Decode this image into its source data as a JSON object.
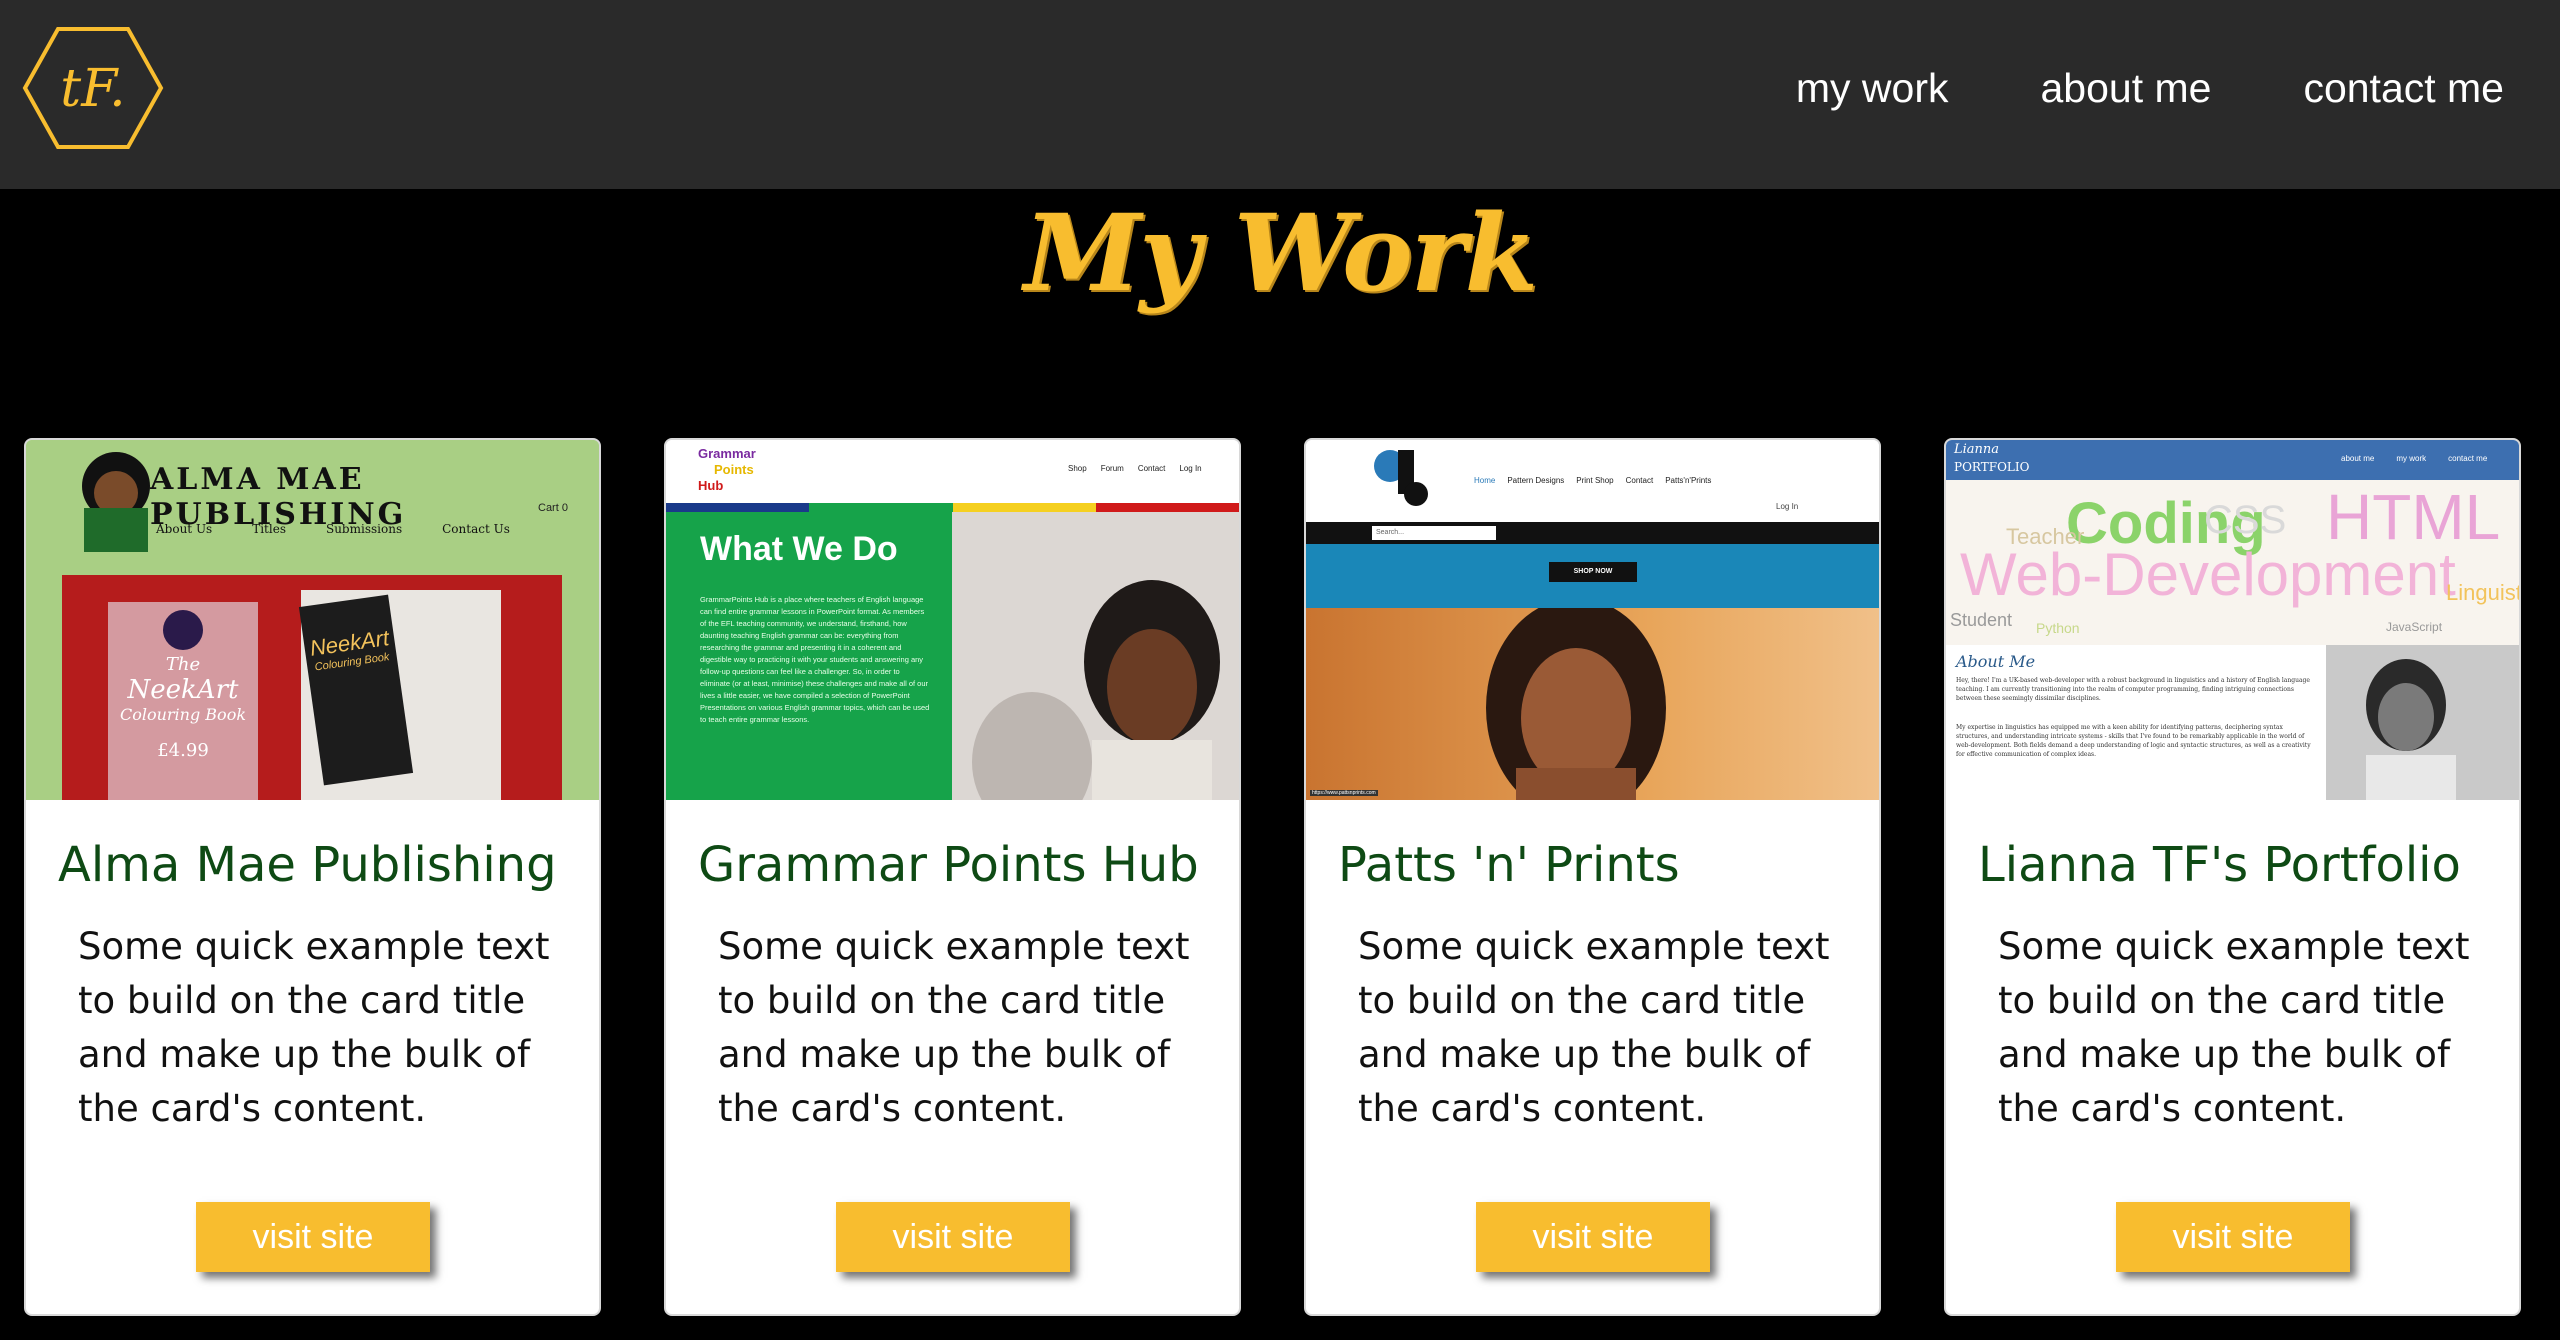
{
  "nav": {
    "logo_text": "tF.",
    "links": [
      "my work",
      "about me",
      "contact me"
    ]
  },
  "page": {
    "title": "My Work"
  },
  "colors": {
    "accent": "#f8bd2f",
    "title_green": "#0e4a14",
    "nav_bg": "#2a2a2a"
  },
  "cards": [
    {
      "title": "Alma Mae Publishing",
      "text": "Some quick example text to build on the card title and make up the bulk of the card's content.",
      "button": "visit site",
      "thumb": {
        "brand": "ALMA MAE PUBLISHING",
        "menu": [
          "About Us",
          "Titles",
          "Submissions",
          "Contact Us"
        ],
        "cart": "Cart 0",
        "book_line1": "The",
        "book_line2": "NeekArt",
        "book_line3": "Colouring Book",
        "price": "£4.99",
        "book_cover": "NeekArt",
        "book_cover_sub": "Colouring Book"
      }
    },
    {
      "title": "Grammar Points Hub",
      "text": "Some quick example text to build on the card title and make up the bulk of the card's content.",
      "button": "visit site",
      "thumb": {
        "logo_line1": "Grammar",
        "logo_line2": "Points",
        "logo_line3": "Hub",
        "menu": [
          "Shop",
          "Forum",
          "Contact",
          "Log In"
        ],
        "heading": "What We Do",
        "body": "GrammarPoints Hub is a place where teachers of English language can find entire grammar lessons in PowerPoint format. As members of the EFL teaching community, we understand, firsthand, how daunting teaching English grammar can be: everything from researching the grammar and presenting it in a coherent and digestible way to practicing it with your students and answering any follow-up questions can feel like a challenger. So, in order to eliminate (or at least, minimise) these challenges and make all of our lives a little easier, we have compiled a selection of PowerPoint Presentations on various English grammar topics, which can be used to teach entire grammar lessons."
      }
    },
    {
      "title": "Patts 'n' Prints",
      "text": "Some quick example text to build on the card title and make up the bulk of the card's content.",
      "button": "visit site",
      "thumb": {
        "menu": [
          "Home",
          "Pattern Designs",
          "Print Shop",
          "Contact",
          "Patts'n'Prints"
        ],
        "login": "Log In",
        "search": "Search...",
        "shop_btn": "SHOP NOW",
        "url": "https://www.pattsnprints.com"
      }
    },
    {
      "title": "Lianna TF's Portfolio",
      "text": "Some quick example text to build on the card title and make up the bulk of the card's content.",
      "button": "visit site",
      "thumb": {
        "brand_top": "Lianna",
        "brand_bottom": "PORTFOLIO",
        "menu": [
          "about me",
          "my work",
          "contact me"
        ],
        "words": [
          "Coding",
          "HTML",
          "CSS",
          "Web-Development",
          "Teacher",
          "Student",
          "Python",
          "JavaScript",
          "Linguist"
        ],
        "about_title": "About Me",
        "about_p1": "Hey, there! I'm a UK-based web-developer with a robust background in linguistics and a history of English language teaching. I am currently transitioning into the realm of computer programming, finding intriguing connections between these seemingly dissimilar disciplines.",
        "about_p2": "My expertise in linguistics has equipped me with a keen ability for identifying patterns, deciphering syntax structures, and understanding intricate systems - skills that I've found to be remarkably applicable in the world of web-development. Both fields demand a deep understanding of logic and syntactic structures, as well as a creativity for effective communication of complex ideas."
      }
    }
  ]
}
